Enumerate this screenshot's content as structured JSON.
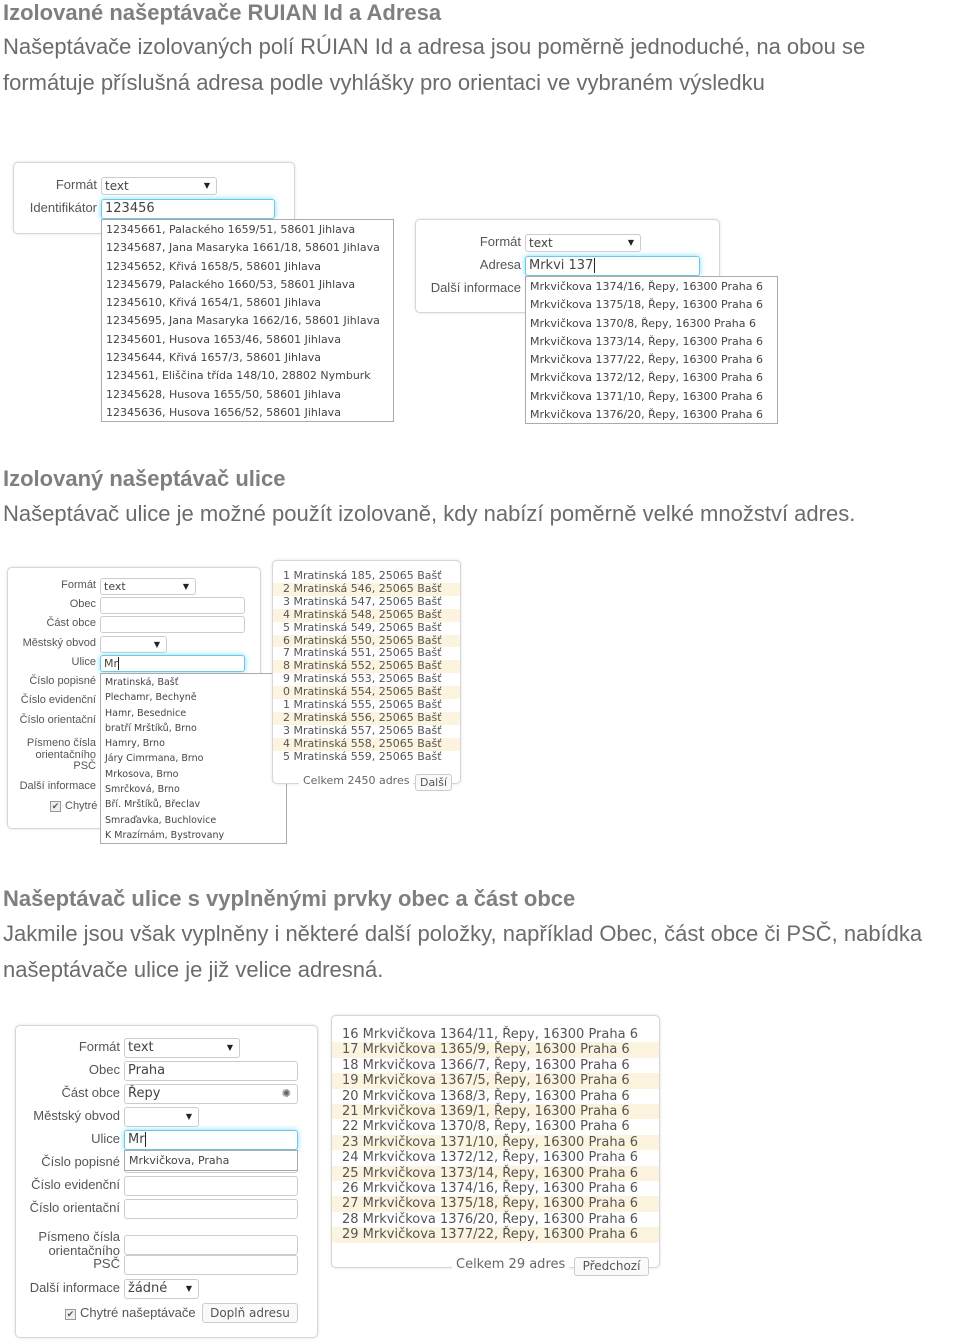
{
  "section1": {
    "heading": "Izolované našeptávače RUIAN Id a Adresa",
    "paragraph": [
      "Našeptávače izolovaných polí RÚIAN Id a adresa jsou poměrně jednoduché, na obou se",
      "formátuje příslušná adresa podle vyhlášky pro orientaci ve vybraném výsledku"
    ],
    "id_form": {
      "format_label": "Formát",
      "format_value": "text",
      "id_label": "Identifikátor",
      "id_value": "123456",
      "suggestions": [
        "12345661, Palackého 1659/51, 58601 Jihlava",
        "12345687, Jana Masaryka 1661/18, 58601 Jihlava",
        "12345652, Křivá 1658/5, 58601 Jihlava",
        "12345679, Palackého 1660/53, 58601 Jihlava",
        "12345610, Křivá 1654/1, 58601 Jihlava",
        "12345695, Jana Masaryka 1662/16, 58601 Jihlava",
        "12345601, Husova 1653/46, 58601 Jihlava",
        "12345644, Křivá 1657/3, 58601 Jihlava",
        "1234561, Eliščina třída 148/10, 28802 Nymburk",
        "12345628, Husova 1655/50, 58601 Jihlava",
        "12345636, Husova 1656/52, 58601 Jihlava"
      ]
    },
    "address_form": {
      "format_label": "Formát",
      "format_value": "text",
      "address_label": "Adresa",
      "address_value": "Mrkvi 137",
      "info_label": "Další informace",
      "suggestions": [
        "Mrkvičkova 1374/16, Řepy, 16300 Praha 6",
        "Mrkvičkova 1375/18, Řepy, 16300 Praha 6",
        "Mrkvičkova 1370/8, Řepy, 16300 Praha 6",
        "Mrkvičkova 1373/14, Řepy, 16300 Praha 6",
        "Mrkvičkova 1377/22, Řepy, 16300 Praha 6",
        "Mrkvičkova 1372/12, Řepy, 16300 Praha 6",
        "Mrkvičkova 1371/10, Řepy, 16300 Praha 6",
        "Mrkvičkova 1376/20, Řepy, 16300 Praha 6"
      ]
    }
  },
  "section2": {
    "heading": "Izolovaný našeptávač ulice",
    "paragraph": [
      "Našeptávač ulice je možné použít izolovaně, kdy nabízí poměrně velké množství adres."
    ],
    "form": {
      "fields": [
        {
          "label": "Formát",
          "type": "select",
          "value": "text"
        },
        {
          "label": "Obec",
          "type": "input",
          "value": ""
        },
        {
          "label": "Část obce",
          "type": "input",
          "value": ""
        },
        {
          "label": "Městský obvod",
          "type": "select",
          "value": ""
        },
        {
          "label": "Ulice",
          "type": "input",
          "value": "Mr",
          "focused": true
        },
        {
          "label": "Číslo popisné",
          "type": "none"
        },
        {
          "label": "Číslo evidenční",
          "type": "none"
        },
        {
          "label": "Číslo orientační",
          "type": "none"
        },
        {
          "label": "Písmeno čísla orientačního",
          "type": "none"
        },
        {
          "label": "PSČ",
          "type": "none"
        },
        {
          "label": "Další informace",
          "type": "none"
        }
      ],
      "checkbox_label": "Chytré",
      "checkbox_checked": true,
      "suggestions": [
        "Mratinská, Bašť",
        "Plechamr, Bechyně",
        "Hamr, Besednice",
        "bratří Mrštíků, Brno",
        "Hamry, Brno",
        "Járy Cimrmana, Brno",
        "Mrkosova, Brno",
        "Smrčková, Brno",
        "Bří. Mrštíků, Břeclav",
        "Smraďavka, Buchlovice",
        "K Mrazírnám, Bystrovany"
      ]
    },
    "results": {
      "items": [
        "1 Mratinská 185, 25065 Bašť",
        "2 Mratinská 546, 25065 Bašť",
        "3 Mratinská 547, 25065 Bašť",
        "4 Mratinská 548, 25065 Bašť",
        "5 Mratinská 549, 25065 Bašť",
        "6 Mratinská 550, 25065 Bašť",
        "7 Mratinská 551, 25065 Bašť",
        "8 Mratinská 552, 25065 Bašť",
        "9 Mratinská 553, 25065 Bašť",
        "0 Mratinská 554, 25065 Bašť",
        "1 Mratinská 555, 25065 Bašť",
        "2 Mratinská 556, 25065 Bašť",
        "3 Mratinská 557, 25065 Bašť",
        "4 Mratinská 558, 25065 Bašť",
        "5 Mratinská 559, 25065 Bašť"
      ],
      "total": "Celkem 2450 adres",
      "button": "Další"
    }
  },
  "section3": {
    "heading": "Našeptávač ulice s vyplněnými prvky obec a část obce",
    "paragraph": [
      "Jakmile jsou však vyplněny i některé další položky, například Obec, část obce či PSČ, nabídka",
      "našeptávače ulice je již velice adresná."
    ],
    "form": {
      "fields": [
        {
          "label": "Formát",
          "type": "select",
          "value": "text"
        },
        {
          "label": "Obec",
          "type": "input",
          "value": "Praha"
        },
        {
          "label": "Část obce",
          "type": "input",
          "value": "Řepy",
          "loading": true
        },
        {
          "label": "Městský obvod",
          "type": "select",
          "value": ""
        },
        {
          "label": "Ulice",
          "type": "input",
          "value": "Mr",
          "focused": true
        },
        {
          "label": "Číslo popisné",
          "type": "input",
          "value": ""
        },
        {
          "label": "Číslo evidenční",
          "type": "input",
          "value": ""
        },
        {
          "label": "Číslo orientační",
          "type": "input",
          "value": ""
        },
        {
          "label": "Písmeno čísla orientačního",
          "type": "input",
          "value": ""
        },
        {
          "label": "PSČ",
          "type": "input",
          "value": ""
        },
        {
          "label": "Další informace",
          "type": "select",
          "value": "žádné"
        }
      ],
      "checkbox_label": "Chytré našeptávače",
      "checkbox_checked": true,
      "submit_button": "Doplň adresu",
      "suggestions": [
        "Mrkvičkova, Praha"
      ]
    },
    "results": {
      "items": [
        "16 Mrkvičkova 1364/11, Řepy, 16300 Praha 6",
        "17 Mrkvičkova 1365/9, Řepy, 16300 Praha 6",
        "18 Mrkvičkova 1366/7, Řepy, 16300 Praha 6",
        "19 Mrkvičkova 1367/5, Řepy, 16300 Praha 6",
        "20 Mrkvičkova 1368/3, Řepy, 16300 Praha 6",
        "21 Mrkvičkova 1369/1, Řepy, 16300 Praha 6",
        "22 Mrkvičkova 1370/8, Řepy, 16300 Praha 6",
        "23 Mrkvičkova 1371/10, Řepy, 16300 Praha 6",
        "24 Mrkvičkova 1372/12, Řepy, 16300 Praha 6",
        "25 Mrkvičkova 1373/14, Řepy, 16300 Praha 6",
        "26 Mrkvičkova 1374/16, Řepy, 16300 Praha 6",
        "27 Mrkvičkova 1375/18, Řepy, 16300 Praha 6",
        "28 Mrkvičkova 1376/20, Řepy, 16300 Praha 6",
        "29 Mrkvičkova 1377/22, Řepy, 16300 Praha 6"
      ],
      "total": "Celkem 29 adres",
      "button": "Předchozí"
    }
  },
  "colors": {
    "focus_glow": "#7fdcf5",
    "row_highlight": "#fcf4de",
    "heading": "#7f7f7f"
  }
}
